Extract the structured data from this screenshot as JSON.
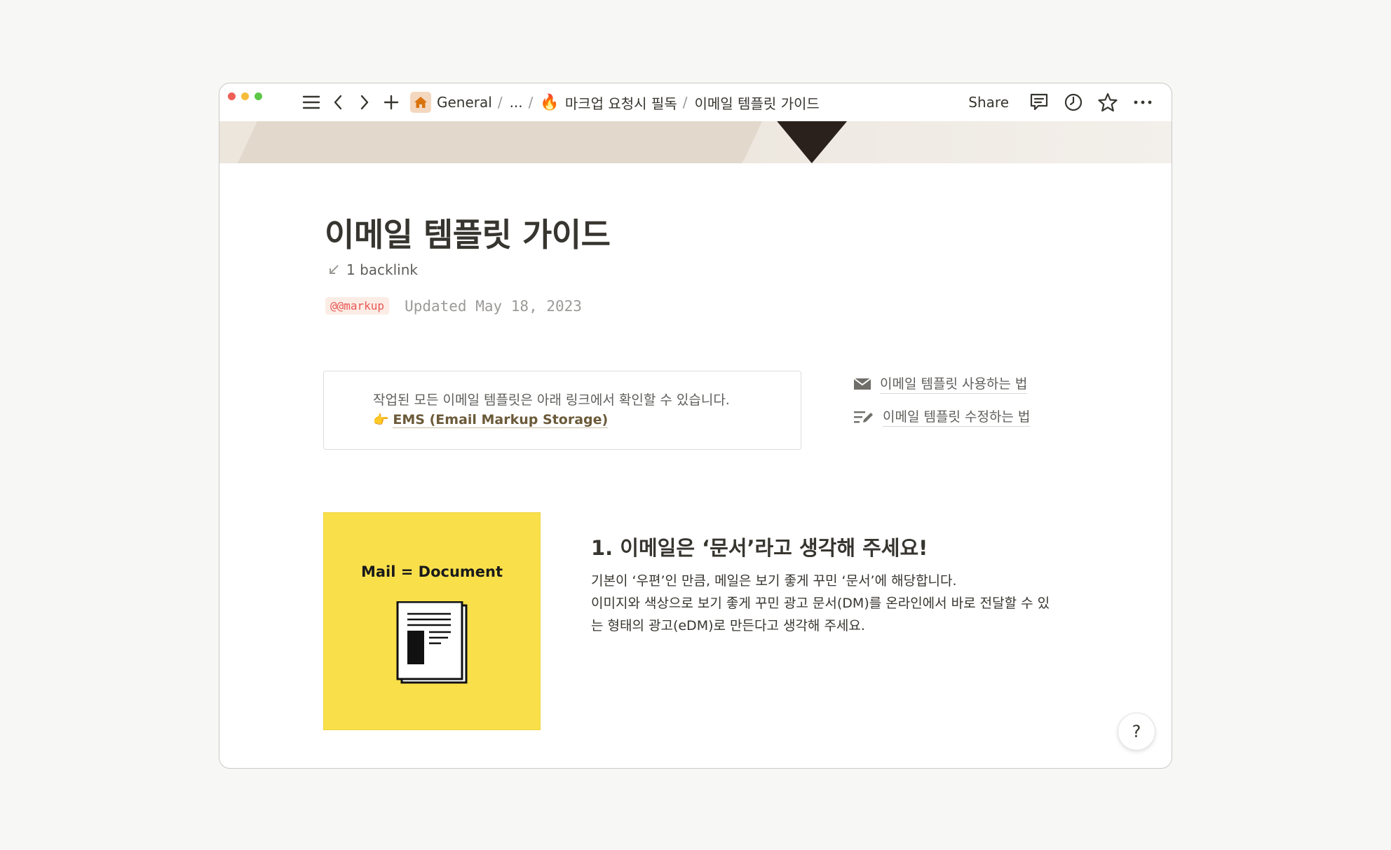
{
  "breadcrumb": {
    "items": [
      {
        "label": "General",
        "icon": "home-icon"
      },
      {
        "label": "..."
      },
      {
        "label": "마크업 요청시 필독",
        "icon": "fire-emoji",
        "emoji": "🔥"
      },
      {
        "label": "이메일 템플릿 가이드"
      }
    ]
  },
  "topbar": {
    "share_label": "Share",
    "icons": [
      "menu-icon",
      "back-icon",
      "forward-icon",
      "add-icon",
      "comment-icon",
      "history-icon",
      "favorite-icon",
      "more-icon"
    ]
  },
  "page": {
    "title": "이메일 템플릿 가이드",
    "backlink": "1 backlink",
    "tag": "@@markup",
    "updated": "Updated May 18, 2023"
  },
  "callout": {
    "text": "작업된 모든 이메일 템플릿은 아래 링크에서 확인할 수 있습니다.",
    "pointer": "👉",
    "link_label": "EMS (Email Markup Storage)"
  },
  "side_links": [
    {
      "label": "이메일 템플릿 사용하는 법",
      "icon": "mail-icon"
    },
    {
      "label": "이메일 템플릿 수정하는 법",
      "icon": "edit-list-icon"
    }
  ],
  "card": {
    "caption": "Mail = Document",
    "background": "#f9e04b"
  },
  "section": {
    "heading": "1. 이메일은 ‘문서’라고 생각해 주세요!",
    "lines": [
      "기본이 ‘우편’인 만큼, 메일은 보기 좋게 꾸민 ‘문서’에 해당합니다.",
      "이미지와 색상으로 보기 좋게 꾸민 광고 문서(DM)를 온라인에서 바로 전달할 수 있",
      "는 형태의 광고(eDM)로 만든다고 생각해 주세요."
    ]
  },
  "help_label": "?"
}
